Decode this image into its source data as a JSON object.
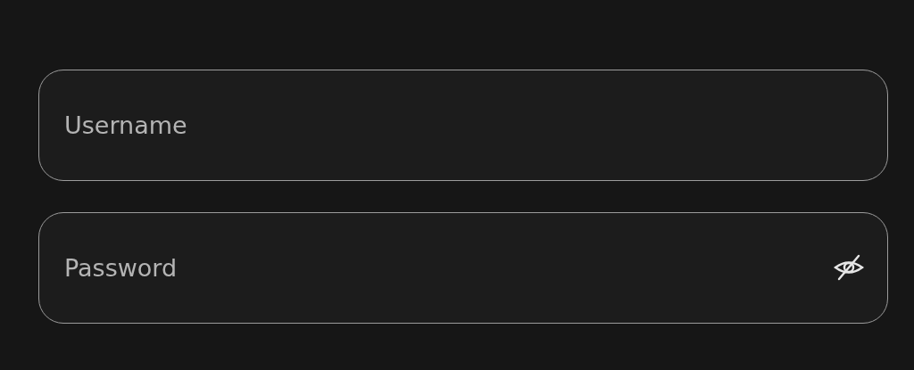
{
  "fields": [
    {
      "kind": "text",
      "placeholder": "Username"
    },
    {
      "kind": "password",
      "placeholder": "Password",
      "revealed": false
    }
  ]
}
